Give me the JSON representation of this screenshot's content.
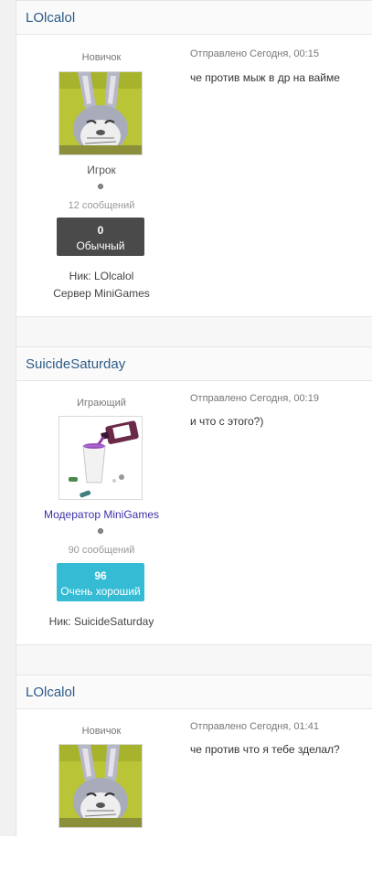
{
  "posts": [
    {
      "author": "LOlcalol",
      "rank_title": "Новичок",
      "group": "Игрок",
      "post_count": "12 сообщений",
      "rep_value": "0",
      "rep_label": "Обычный",
      "field_nick": "Ник: LOlcalol",
      "field_server": "Сервер MiniGames",
      "date": "Отправлено Сегодня, 00:15",
      "text": "че против мыж в др на вайме"
    },
    {
      "author": "SuicideSaturday",
      "rank_title": "Играющий",
      "group": "Модератор MiniGames",
      "post_count": "90 сообщений",
      "rep_value": "96",
      "rep_label": "Очень хороший",
      "field_nick": "Ник: SuicideSaturday",
      "date": "Отправлено Сегодня, 00:19",
      "text": "и что с этого?)"
    },
    {
      "author": "LOlcalol",
      "rank_title": "Новичок",
      "date": "Отправлено Сегодня, 01:41",
      "text": "че против что я тебе зделал?"
    }
  ],
  "colors": {
    "link": "#2d5c88",
    "moderator": "#3a32a8",
    "rep_normal": "#4a4a4a",
    "rep_good": "#35bcd4"
  },
  "icons": {
    "avatar_1": "bugs-bunny-avatar",
    "avatar_2": "cup-bottle-avatar",
    "status": "status-dot-icon"
  }
}
